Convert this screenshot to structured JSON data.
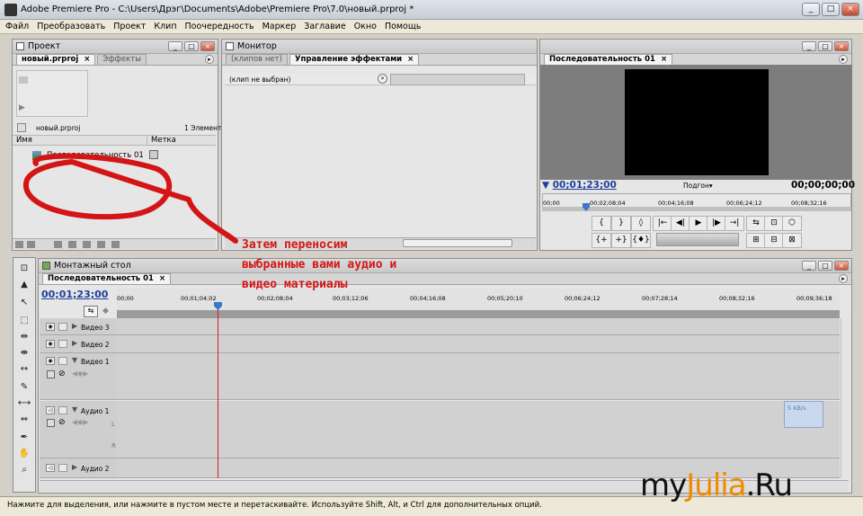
{
  "window": {
    "title": "Adobe Premiere Pro - C:\\Users\\Дрэг\\Documents\\Adobe\\Premiere Pro\\7.0\\новый.prproj *",
    "buttons": [
      "_",
      "□",
      "×"
    ]
  },
  "menu": [
    "Файл",
    "Преобразовать",
    "Проект",
    "Клип",
    "Поочередность",
    "Маркер",
    "Заглавие",
    "Окно",
    "Помощь"
  ],
  "project_panel": {
    "title": "Проект",
    "tabs": [
      {
        "label": "новый.prproj",
        "close": "×"
      },
      {
        "label": "Эффекты"
      }
    ],
    "file_name": "новый.prproj",
    "item_count": "1 Элемент",
    "columns": [
      "Имя",
      "Метка"
    ],
    "items": [
      "Последовательность 01"
    ]
  },
  "monitor_panel": {
    "title": "Монитор",
    "tabs": [
      {
        "label": "(клипов нет)"
      },
      {
        "label": "Управление эффектами",
        "close": "×"
      }
    ],
    "no_clip": "(клип не выбран)",
    "ec_button": "»"
  },
  "program_monitor": {
    "tab": "Последовательность 01",
    "tab_close": "×",
    "timecode_current": "00;01;23;00",
    "fit_label": "Подгон",
    "timecode_duration": "00;00;00;00",
    "ruler_labels": [
      "00;00",
      "00;02;08;04",
      "00;04;16;08",
      "00;06;24;12",
      "00;08;32;16"
    ],
    "controls_row1": [
      "{",
      "}",
      "◊",
      "|←",
      "◀|",
      "▶",
      "|▶",
      "→|",
      "⇆",
      "⊡",
      "⬡"
    ],
    "controls_row2": [
      "{+",
      "+}",
      "{♦}",
      "⊞",
      "⊟",
      "⊠"
    ]
  },
  "timeline": {
    "title": "Монтажный стол",
    "tab": "Последовательность 01",
    "tab_close": "×",
    "timecode": "00;01;23;00",
    "ruler_labels": [
      "00;00",
      "00;01;04;02",
      "00;02;08;04",
      "00;03;12;06",
      "00;04;16;08",
      "00;05;20;10",
      "00;06;24;12",
      "00;07;28;14",
      "00;08;32;16",
      "00;09;36;18"
    ],
    "tracks": [
      "Видео 3",
      "Видео 2",
      "Видео 1",
      "Аудио 1",
      "Аудио 2"
    ],
    "audio_channel_labels": [
      "L",
      "R"
    ]
  },
  "speed_indicator": "5 KB/s",
  "status_bar": "Нажмите для выделения, или нажмите в пустом месте и перетаскивайте. Используйте Shift, Alt, и Ctrl для дополнительных опций.",
  "annotation_lines": [
    "Затем переносим",
    "выбранные вами аудио и",
    "видео материалы"
  ],
  "watermark": {
    "part1": "my",
    "part2": "Julia",
    "part3": ".Ru"
  },
  "colors": {
    "annotation": "#d41515",
    "timecode": "#1f3f9a",
    "playhead": "#d02020",
    "accent": "#f28a00"
  }
}
